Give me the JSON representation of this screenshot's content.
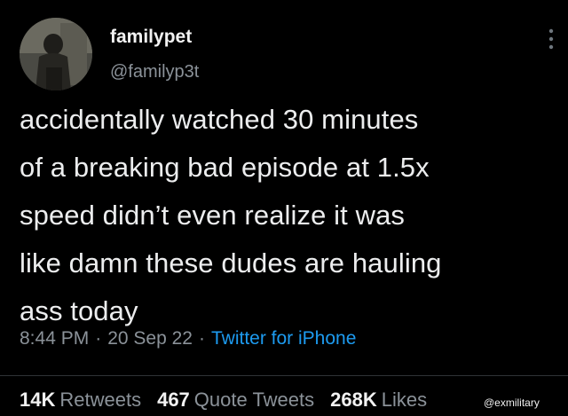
{
  "author": {
    "display_name": "familypet",
    "handle": "@familyp3t"
  },
  "tweet": {
    "lines": [
      "accidentally watched 30 minutes",
      "of a breaking bad episode at 1.5x",
      "speed didn’t even realize it was",
      "like damn these dudes are hauling",
      "ass today"
    ],
    "time": "8:44 PM",
    "date": "20 Sep 22",
    "separator": "·",
    "source": "Twitter for iPhone"
  },
  "stats": {
    "retweets_count": "14K",
    "retweets_label": "Retweets",
    "quotes_count": "467",
    "quotes_label": "Quote Tweets",
    "likes_count": "268K",
    "likes_label": "Likes"
  },
  "watermark": "@exmilitary",
  "icons": {
    "more": "more-vertical-icon",
    "avatar": "profile-avatar"
  },
  "colors": {
    "background": "#000000",
    "text": "#e7e9ea",
    "secondary": "#8b9299",
    "link": "#1d9bf0"
  }
}
